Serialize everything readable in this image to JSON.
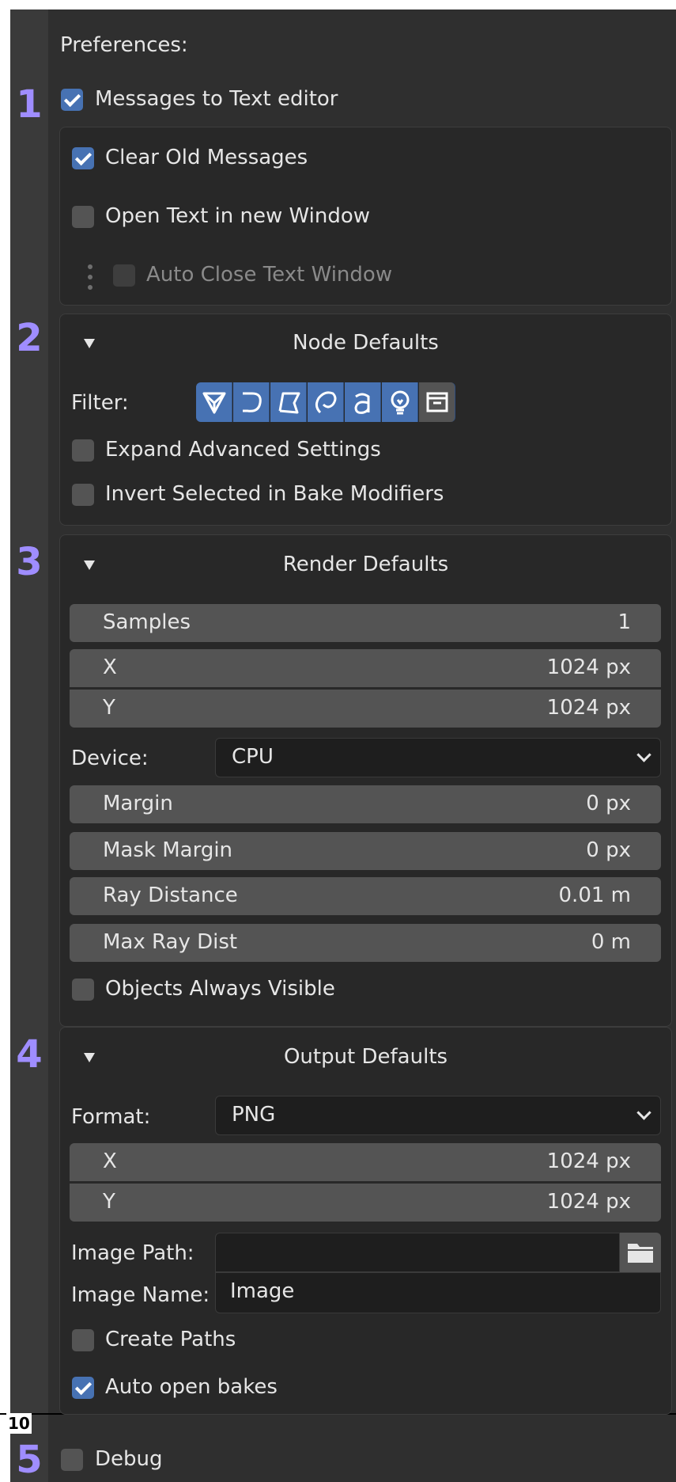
{
  "preferences": {
    "title": "Preferences:",
    "messages_to_text_editor": {
      "label": "Messages to Text editor",
      "checked": true
    },
    "clear_old_messages": {
      "label": "Clear Old Messages",
      "checked": true
    },
    "open_text_new_window": {
      "label": "Open Text in new Window",
      "checked": false
    },
    "auto_close_text_window": {
      "label": "Auto Close Text Window",
      "checked": false,
      "enabled": false
    }
  },
  "node_defaults": {
    "title": "Node Defaults",
    "filter_label": "Filter:",
    "filter_buttons": [
      {
        "icon": "mesh-icon",
        "active": true
      },
      {
        "icon": "curve-icon",
        "active": true
      },
      {
        "icon": "surface-icon",
        "active": true
      },
      {
        "icon": "meta-icon",
        "active": true
      },
      {
        "icon": "font-icon",
        "active": true
      },
      {
        "icon": "light-icon",
        "active": true
      },
      {
        "icon": "archive-icon",
        "active": false
      }
    ],
    "expand_advanced": {
      "label": "Expand Advanced Settings",
      "checked": false
    },
    "invert_selected": {
      "label": "Invert Selected in Bake Modifiers",
      "checked": false
    }
  },
  "render_defaults": {
    "title": "Render Defaults",
    "samples": {
      "label": "Samples",
      "value": "1"
    },
    "x": {
      "label": "X",
      "value": "1024 px"
    },
    "y": {
      "label": "Y",
      "value": "1024 px"
    },
    "device_label": "Device:",
    "device_value": "CPU",
    "margin": {
      "label": "Margin",
      "value": "0 px"
    },
    "mask_margin": {
      "label": "Mask Margin",
      "value": "0 px"
    },
    "ray_distance": {
      "label": "Ray Distance",
      "value": "0.01 m"
    },
    "max_ray_dist": {
      "label": "Max Ray Dist",
      "value": "0 m"
    },
    "objects_always_visible": {
      "label": "Objects Always Visible",
      "checked": false
    }
  },
  "output_defaults": {
    "title": "Output Defaults",
    "format_label": "Format:",
    "format_value": "PNG",
    "x": {
      "label": "X",
      "value": "1024 px"
    },
    "y": {
      "label": "Y",
      "value": "1024 px"
    },
    "image_path_label": "Image Path:",
    "image_path_value": "",
    "image_name_label": "Image Name:",
    "image_name_value": "Image",
    "create_paths": {
      "label": "Create Paths",
      "checked": false
    },
    "auto_open_bakes": {
      "label": "Auto open bakes",
      "checked": true
    }
  },
  "debug": {
    "label": "Debug",
    "checked": false
  },
  "annotations": {
    "n1": "1",
    "n2": "2",
    "n3": "3",
    "n4": "4",
    "n5": "5",
    "n10": "10"
  },
  "colors": {
    "accent": "#4772b3",
    "annotation": "#9f8dff",
    "background": "#2f2f2f"
  }
}
